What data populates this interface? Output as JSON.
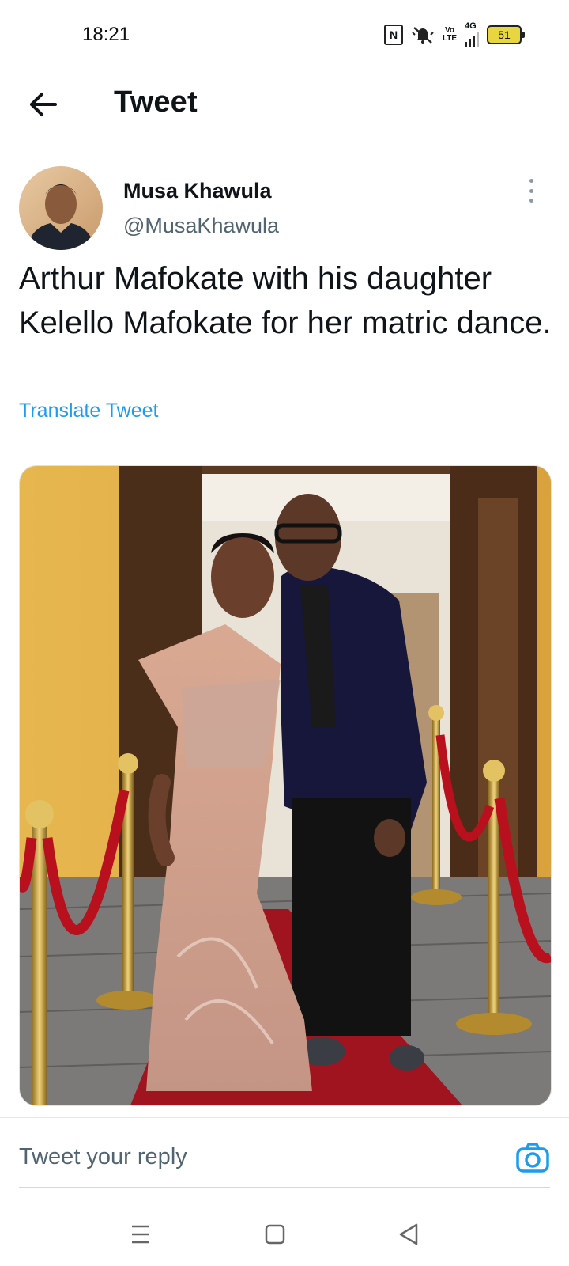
{
  "status_bar": {
    "time": "18:21",
    "volte": "Vo LTE",
    "network": "4G",
    "battery": "51",
    "nfc": "N"
  },
  "header": {
    "title": "Tweet",
    "back_icon": "arrow-left-icon"
  },
  "tweet": {
    "author_name": "Musa Khawula",
    "author_handle": "@MusaKhawula",
    "text": "Arthur Mafokate with his daughter Kelello Mafokate for her matric dance.",
    "translate_label": "Translate Tweet",
    "more_icon": "more-vertical-icon"
  },
  "reply": {
    "placeholder": "Tweet your reply",
    "camera_icon": "camera-icon"
  },
  "nav_bar": {
    "icons": [
      "menu-icon",
      "home-square-icon",
      "back-triangle-icon"
    ]
  },
  "colors": {
    "accent": "#1d9bf0",
    "text_primary": "#0f1419",
    "text_secondary": "#536471"
  }
}
